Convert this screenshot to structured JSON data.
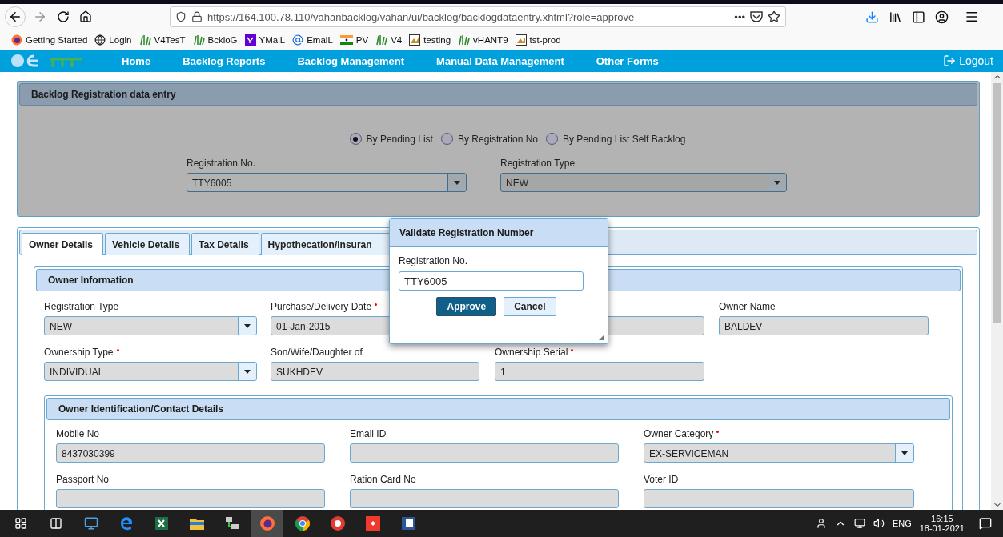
{
  "browser": {
    "url": "https://164.100.78.110/vahanbacklog/vahan/ui/backlog/backlogdataentry.xhtml?role=approve",
    "menu_dots": "•••",
    "bookmarks": [
      {
        "label": "Getting Started",
        "kind": "firefox"
      },
      {
        "label": "Login",
        "kind": "globe"
      },
      {
        "label": "V4TesT",
        "kind": "vahan"
      },
      {
        "label": "BckloG",
        "kind": "vahan"
      },
      {
        "label": "YMaiL",
        "kind": "yahoo"
      },
      {
        "label": "EmaiL",
        "kind": "at"
      },
      {
        "label": "PV",
        "kind": "flag"
      },
      {
        "label": "V4",
        "kind": "vahan"
      },
      {
        "label": "testing",
        "kind": "image"
      },
      {
        "label": "vHANT9",
        "kind": "vahan"
      },
      {
        "label": "tst-prod",
        "kind": "image"
      }
    ]
  },
  "nav": {
    "items": [
      "Home",
      "Backlog Reports",
      "Backlog Management",
      "Manual Data Management",
      "Other Forms"
    ],
    "logout": "Logout"
  },
  "panel": {
    "title": "Backlog Registration data entry",
    "radios": [
      {
        "label": "By Pending List",
        "selected": true
      },
      {
        "label": "By Registration No",
        "selected": false
      },
      {
        "label": "By Pending List Self Backlog",
        "selected": false
      }
    ],
    "fields": [
      {
        "label": "Registration No.",
        "value": "TTY6005"
      },
      {
        "label": "Registration Type",
        "value": "NEW"
      }
    ]
  },
  "tabs": [
    {
      "label": "Owner Details",
      "selected": true
    },
    {
      "label": "Vehicle Details",
      "selected": false
    },
    {
      "label": "Tax Details",
      "selected": false
    },
    {
      "label": "Hypothecation/Insuran",
      "selected": false
    }
  ],
  "owner_information": {
    "title": "Owner Information",
    "fields": [
      {
        "label": "Registration Type",
        "value": "NEW",
        "kind": "select",
        "required": false
      },
      {
        "label": "Purchase/Delivery Date",
        "value": "01-Jan-2015",
        "kind": "text",
        "required": true
      },
      {
        "kind": "text"
      },
      {
        "label": "Owner Name",
        "value": "BALDEV",
        "kind": "text",
        "required": false
      },
      {
        "label": "Ownership Type",
        "value": "INDIVIDUAL",
        "kind": "select",
        "required": true
      },
      {
        "label": "Son/Wife/Daughter of",
        "value": "SUKHDEV",
        "kind": "text",
        "required": false
      },
      {
        "label": "Ownership Serial",
        "value": "1",
        "kind": "text",
        "required": true
      }
    ]
  },
  "identification": {
    "title": "Owner Identification/Contact Details",
    "fields": [
      {
        "label": "Mobile No",
        "value": "8437030399",
        "kind": "text",
        "required": false
      },
      {
        "label": "Email ID",
        "kind": "text",
        "required": false
      },
      {
        "label": "Owner Category",
        "value": "EX-SERVICEMAN",
        "kind": "select",
        "required": true
      },
      {
        "label": "Passport No",
        "kind": "text",
        "required": false
      },
      {
        "label": "Ration Card No",
        "kind": "text",
        "required": false
      },
      {
        "label": "Voter ID",
        "kind": "text",
        "required": false
      }
    ]
  },
  "dialog": {
    "title": "Validate Registration Number",
    "label": "Registration No.",
    "value": "TTY6005",
    "buttons": [
      {
        "label": "Approve",
        "kind": "primary"
      },
      {
        "label": "Cancel",
        "kind": "secondary"
      }
    ]
  },
  "taskbar": {
    "apps": [
      {
        "kind": "desktop"
      },
      {
        "kind": "edge"
      },
      {
        "kind": "excel"
      },
      {
        "kind": "folder"
      },
      {
        "kind": "network"
      },
      {
        "kind": "firefox",
        "selected": true
      },
      {
        "kind": "chrome"
      },
      {
        "kind": "red-circle"
      },
      {
        "kind": "red-square"
      },
      {
        "kind": "word"
      }
    ],
    "language": "ENG",
    "time": "16:15",
    "date": "18-01-2021"
  }
}
